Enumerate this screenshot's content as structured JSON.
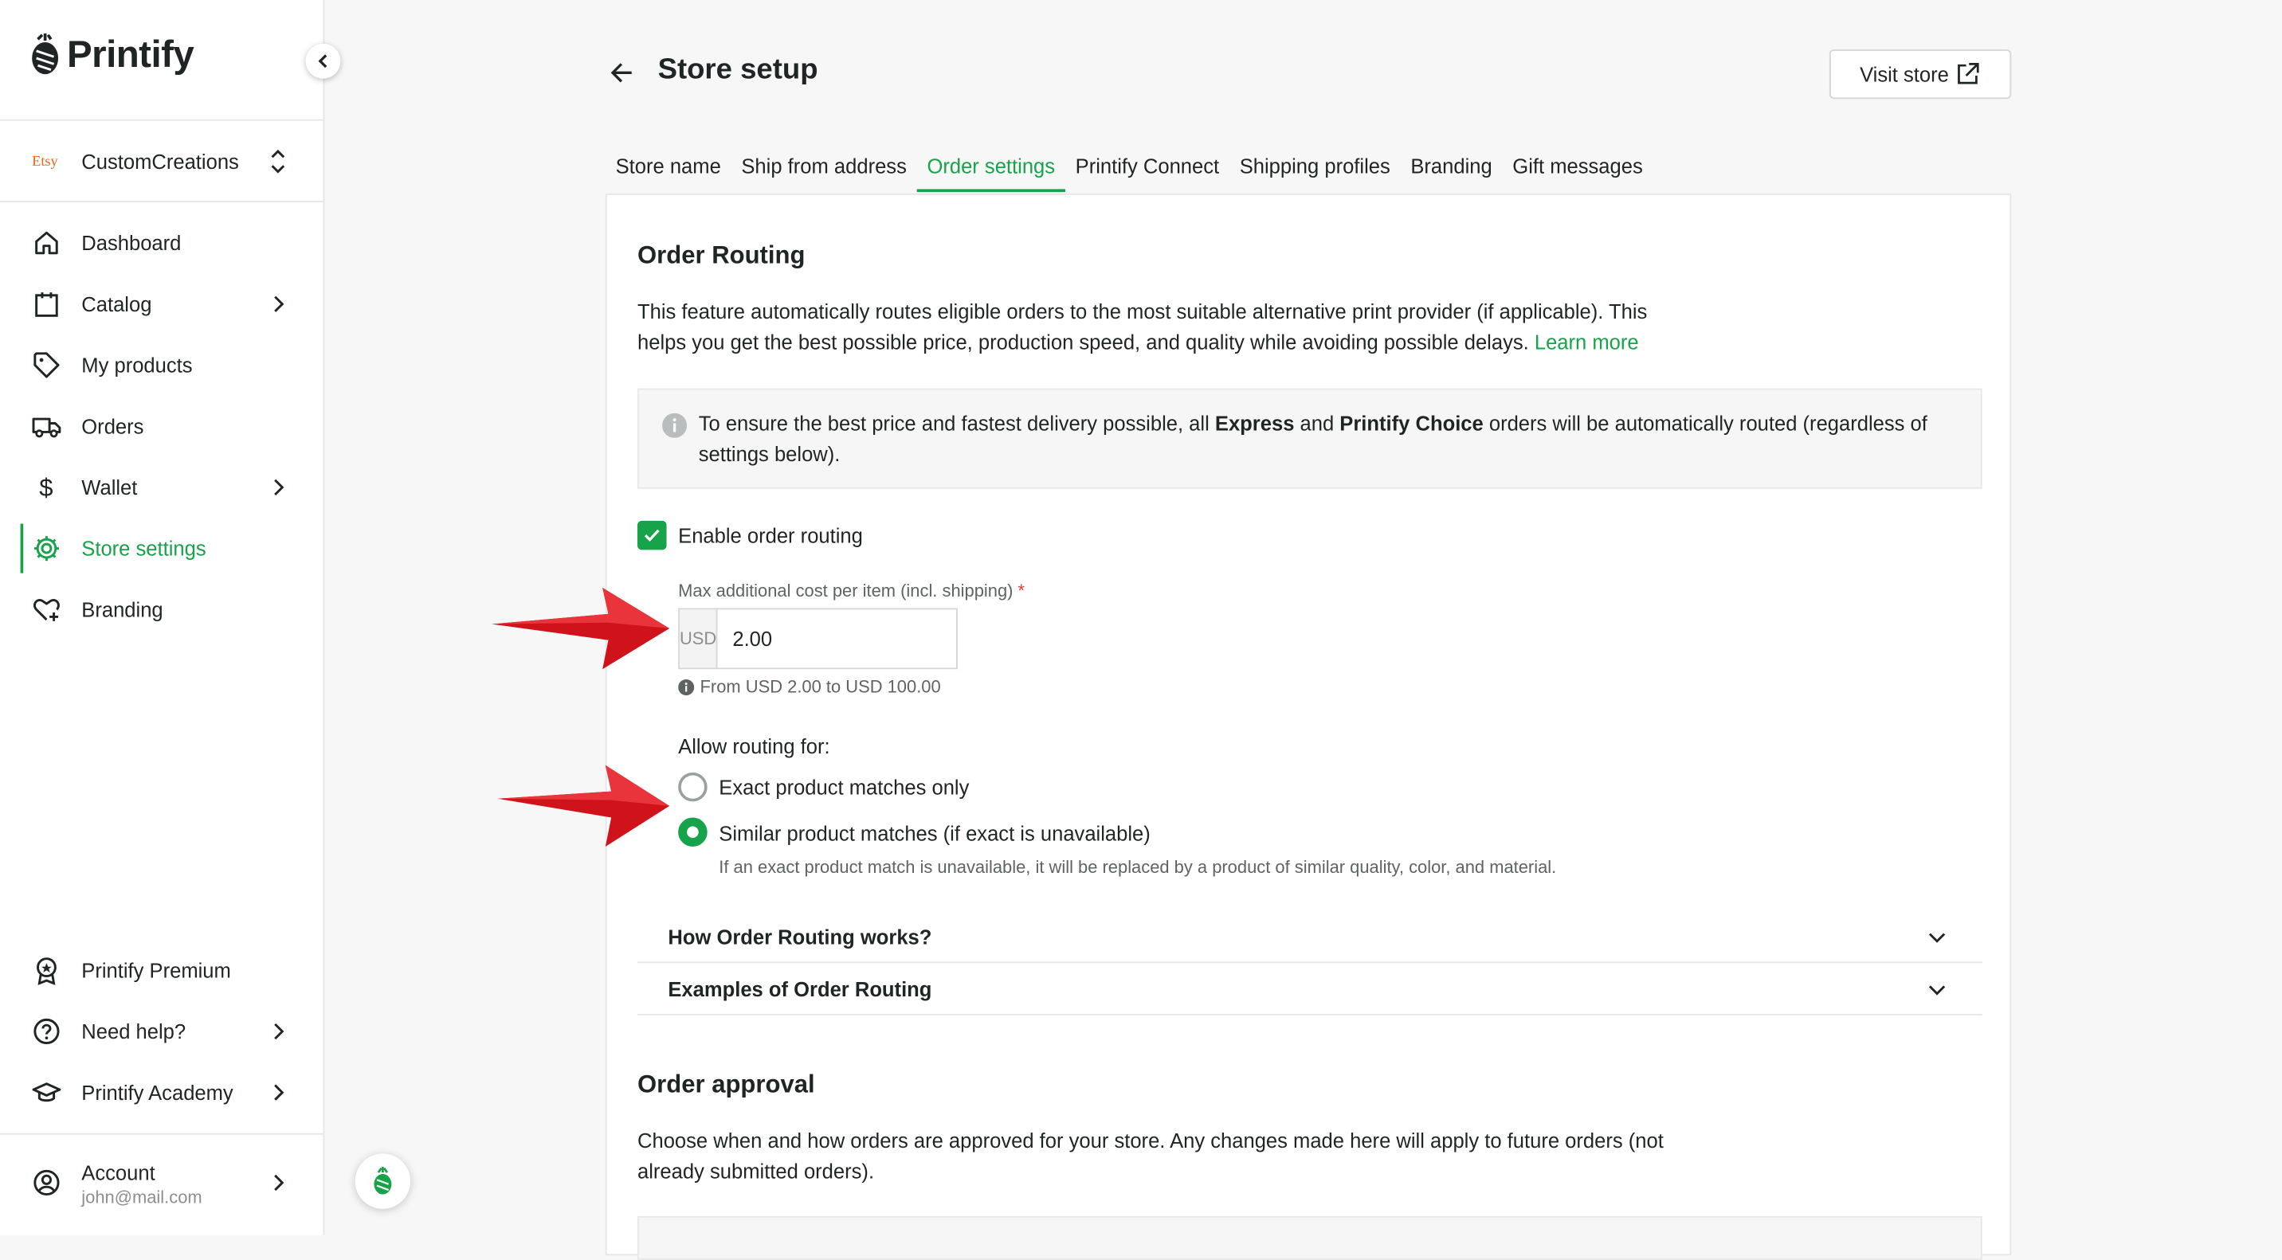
{
  "brand": {
    "name": "Printify",
    "accent": "#17a34a"
  },
  "store": {
    "platform": "Etsy",
    "name": "CustomCreations"
  },
  "nav": {
    "items": [
      {
        "label": "Dashboard",
        "icon": "home-icon"
      },
      {
        "label": "Catalog",
        "icon": "clipboard-icon"
      },
      {
        "label": "My products",
        "icon": "tag-icon"
      },
      {
        "label": "Orders",
        "icon": "truck-icon"
      },
      {
        "label": "Wallet",
        "icon": "dollar-icon"
      },
      {
        "label": "Store settings",
        "icon": "gear-icon"
      },
      {
        "label": "Branding",
        "icon": "heart-plus-icon"
      }
    ],
    "bottom": [
      {
        "label": "Printify Premium",
        "icon": "badge-icon"
      },
      {
        "label": "Need help?",
        "icon": "help-icon"
      },
      {
        "label": "Printify Academy",
        "icon": "graduation-cap-icon"
      }
    ],
    "account": {
      "label": "Account",
      "email": "john@mail.com"
    }
  },
  "header": {
    "title": "Store setup",
    "visit_store": "Visit store"
  },
  "tabs": [
    {
      "label": "Store name"
    },
    {
      "label": "Ship from address"
    },
    {
      "label": "Order settings"
    },
    {
      "label": "Printify Connect"
    },
    {
      "label": "Shipping profiles"
    },
    {
      "label": "Branding"
    },
    {
      "label": "Gift messages"
    }
  ],
  "routing": {
    "title": "Order Routing",
    "desc": "This feature automatically routes eligible orders to the most suitable alternative print provider (if applicable). This helps you get the best possible price, production speed, and quality while avoiding possible delays.",
    "learn_more": "Learn more",
    "info": {
      "pre": "To ensure the best price and fastest delivery possible, all ",
      "b1": "Express",
      "mid": " and ",
      "b2": "Printify Choice",
      "post": " orders will be automatically routed (regardless of settings below)."
    },
    "enable_label": "Enable order routing",
    "enabled": true,
    "max_cost_label": "Max additional cost per item (incl. shipping)",
    "required_mark": "*",
    "currency": "USD",
    "max_cost_value": "2.00",
    "range_hint": "From USD 2.00 to USD 100.00",
    "allow_label": "Allow routing for:",
    "options": [
      {
        "label": "Exact product matches only",
        "selected": false
      },
      {
        "label": "Similar product matches (if exact is unavailable)",
        "selected": true
      }
    ],
    "similar_desc": "If an exact product match is unavailable, it will be replaced by a product of similar quality, color, and material.",
    "accordions": [
      {
        "title": "How Order Routing works?"
      },
      {
        "title": "Examples of Order Routing"
      }
    ]
  },
  "approval": {
    "title": "Order approval",
    "desc": "Choose when and how orders are approved for your store. Any changes made here will apply to future orders (not already submitted orders)."
  }
}
